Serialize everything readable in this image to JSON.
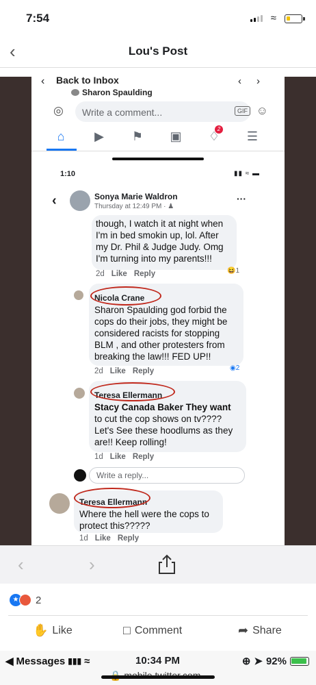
{
  "status_bar": {
    "time": "7:54"
  },
  "header": {
    "title": "Lou's Post"
  },
  "photo": {
    "inbox_label": "Back to Inbox",
    "sharon_label": "Sharon Spaulding",
    "composer_placeholder": "Write a comment...",
    "gif_label": "GIF",
    "inner_time": "1:10",
    "thread": {
      "author": "Sonya Marie Waldron",
      "timestamp": "Thursday at 12:49 PM ·"
    },
    "comments": [
      {
        "name": "",
        "lines": [
          "though, I watch it at night when",
          "I'm in bed smokin up, lol.  After",
          "my Dr. Phil & Judge Judy.  Omg",
          "I'm turning into my parents!!!"
        ],
        "age": "2d",
        "like": "Like",
        "reply": "Reply",
        "reaction_count": "1",
        "reaction_icon": "laugh-icon"
      },
      {
        "name": "Nicola Crane",
        "lines": [
          "Sharon Spaulding god forbid the",
          "cops do their jobs, they might be",
          "considered racists for stopping",
          "BLM , and other protesters from",
          "breaking the law!!! FED UP!!"
        ],
        "age": "2d",
        "like": "Like",
        "reply": "Reply",
        "reaction_count": "2",
        "reaction_icon": "like-icon"
      },
      {
        "name": "Teresa Ellermann",
        "lines": [
          "Stacy Canada Baker They want",
          "to cut the cop shows on tv????",
          "Let's See these hoodlums as they",
          "are!! Keep rolling!"
        ],
        "age": "1d",
        "like": "Like",
        "reply": "Reply"
      },
      {
        "name": "Teresa Ellermann",
        "lines": [
          "Where the hell were the cops to",
          "protect this?????"
        ],
        "age": "1d",
        "like": "Like",
        "reply": "Reply"
      }
    ],
    "reply_placeholder": "Write a reply..."
  },
  "post": {
    "reaction_count": "2",
    "actions": {
      "like": "Like",
      "comment": "Comment",
      "share": "Share"
    }
  },
  "system_bar": {
    "back_app": "Messages",
    "time": "10:34 PM",
    "battery": "92%",
    "url": "mobile.twitter.com"
  },
  "colors": {
    "accent": "#1877f2",
    "annotation": "#c0281c",
    "photo_bg": "#3b2f2d"
  }
}
